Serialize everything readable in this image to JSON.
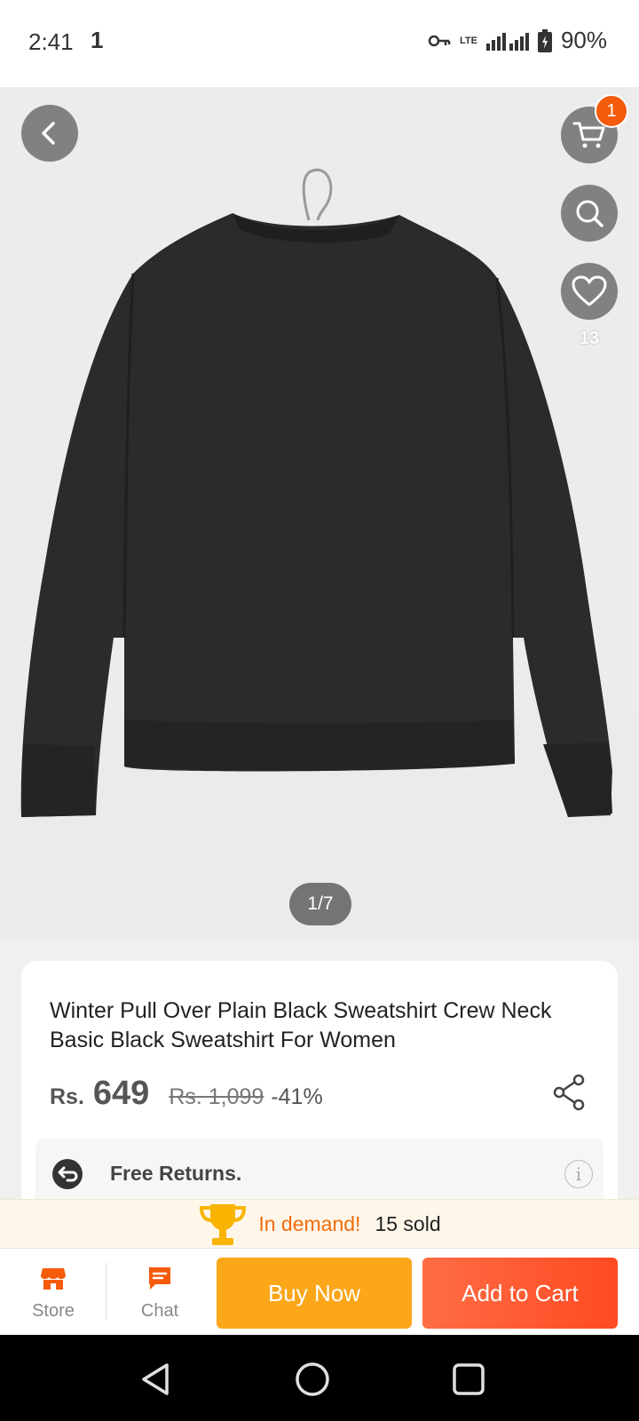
{
  "status_bar": {
    "time": "2:41",
    "notification": "1",
    "network": "LTE",
    "battery": "90%"
  },
  "gallery": {
    "cart_badge": "1",
    "wishlist_count": "13",
    "pager": "1/7"
  },
  "product": {
    "title": "Winter Pull Over Plain Black Sweatshirt Crew Neck Basic Black Sweatshirt For Women",
    "currency": "Rs.",
    "price": "649",
    "original_price": "Rs. 1,099",
    "discount": "-41%",
    "returns_label": "Free Returns."
  },
  "demand": {
    "label": "In demand!",
    "sold": "15 sold"
  },
  "actions": {
    "store_label": "Store",
    "chat_label": "Chat",
    "buy_now": "Buy Now",
    "add_to_cart": "Add to Cart"
  },
  "colors": {
    "accent_orange": "#f45b0a",
    "buy_now": "#fca61a",
    "add_to_cart": "#ff4a22"
  }
}
